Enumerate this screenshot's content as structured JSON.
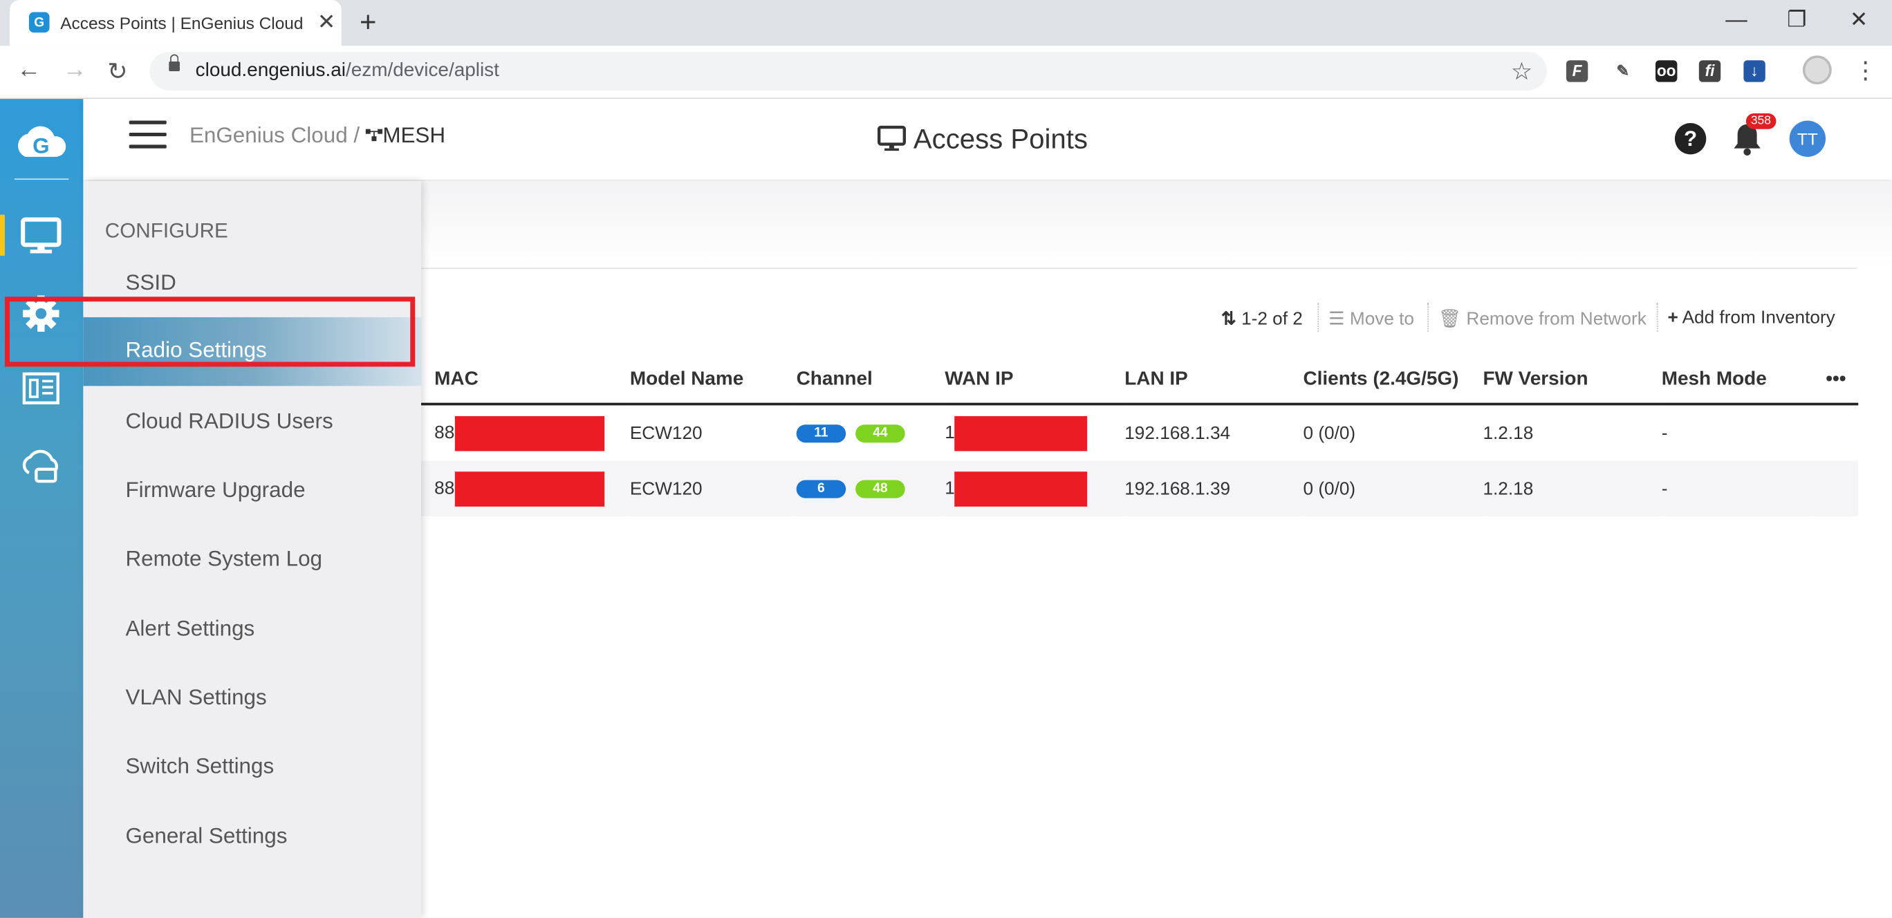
{
  "browser": {
    "tab_title": "Access Points | EnGenius Cloud -",
    "tab_favicon": "G",
    "url_host": "cloud.engenius.ai",
    "url_path": "/ezm/device/aplist"
  },
  "header": {
    "breadcrumb_root": "EnGenius Cloud /",
    "breadcrumb_network": "MESH",
    "page_title": "Access Points",
    "notification_count": "358",
    "avatar_initials": "TT",
    "help_label": "?"
  },
  "configure_menu": {
    "title": "CONFIGURE",
    "items": [
      "SSID",
      "Radio Settings",
      "Cloud RADIUS Users",
      "Firmware Upgrade",
      "Remote System Log",
      "Alert Settings",
      "VLAN Settings",
      "Switch Settings",
      "General Settings"
    ],
    "active_index": 1
  },
  "actions": {
    "pagination": "1-2 of 2",
    "move_to": "Move to",
    "remove": "Remove from Network",
    "add": "Add from Inventory"
  },
  "table": {
    "columns": [
      "MAC",
      "Model Name",
      "Channel",
      "WAN IP",
      "LAN IP",
      "Clients (2.4G/5G)",
      "FW Version",
      "Mesh Mode"
    ],
    "more_label": "•••",
    "rows": [
      {
        "mac_prefix": "88",
        "model": "ECW120",
        "ch_24": "11",
        "ch_5": "44",
        "wan_prefix": "1",
        "lan_ip": "192.168.1.34",
        "clients": "0 (0/0)",
        "fw": "1.2.18",
        "mesh": "-"
      },
      {
        "mac_prefix": "88",
        "model": "ECW120",
        "ch_24": "6",
        "ch_5": "48",
        "wan_prefix": "1",
        "lan_ip": "192.168.1.39",
        "clients": "0 (0/0)",
        "fw": "1.2.18",
        "mesh": "-"
      }
    ]
  },
  "colors": {
    "highlight_box": "#e8202a",
    "redaction": "#ec1c24",
    "rail_top": "#2f9bd8",
    "rail_active_marker": "#f5c518",
    "channel_24": "#1976d2",
    "channel_5": "#7ed321"
  }
}
